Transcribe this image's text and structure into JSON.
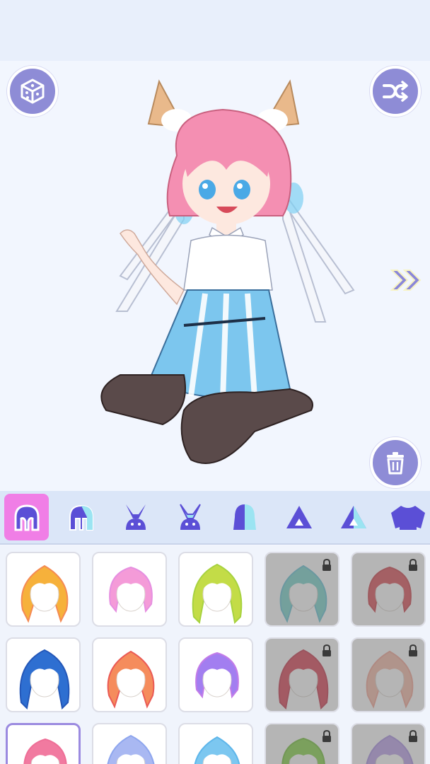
{
  "app": {
    "accent": "#8e8cd6",
    "active_tab_color": "#f07ee6",
    "next_arrow_color": "#8a87d9"
  },
  "toolbar": {
    "random_icon": "dice-icon",
    "shuffle_icon": "shuffle-icon",
    "delete_icon": "trash-icon",
    "next_icon": "double-chevron-right-icon"
  },
  "categories": [
    {
      "icon": "front-hair-icon",
      "active": true
    },
    {
      "icon": "back-hair-icon",
      "active": false
    },
    {
      "icon": "bunny-ears-icon",
      "active": false
    },
    {
      "icon": "bunny-ears-outline-icon",
      "active": false
    },
    {
      "icon": "half-head-icon",
      "active": false
    },
    {
      "icon": "triangle-icon",
      "active": false
    },
    {
      "icon": "triangle-two-tone-icon",
      "active": false
    },
    {
      "icon": "shirt-icon",
      "active": false
    }
  ],
  "hair_items": [
    {
      "color": "#f6b13b",
      "tip": "#f48a54",
      "locked": false,
      "selected": false
    },
    {
      "color": "#f49bd8",
      "tip": "#e68fe0",
      "locked": false,
      "selected": false
    },
    {
      "color": "#c3dc47",
      "tip": "#a7d23f",
      "locked": false,
      "selected": false
    },
    {
      "color": "#6fd1c8",
      "tip": "#5bbfd0",
      "locked": true,
      "selected": false
    },
    {
      "color": "#d9434d",
      "tip": "#c9353f",
      "locked": true,
      "selected": false
    },
    {
      "color": "#2e6fd1",
      "tip": "#2457b8",
      "locked": false,
      "selected": false
    },
    {
      "color": "#f58c5c",
      "tip": "#ea5a55",
      "locked": false,
      "selected": false
    },
    {
      "color": "#a27ef0",
      "tip": "#c27be8",
      "locked": false,
      "selected": false
    },
    {
      "color": "#d7354a",
      "tip": "#c42a40",
      "locked": true,
      "selected": false
    },
    {
      "color": "#f4b5a3",
      "tip": "#f29f8f",
      "locked": true,
      "selected": false
    },
    {
      "color": "#f17aa0",
      "tip": "#ee6f97",
      "locked": false,
      "selected": true
    },
    {
      "color": "#a9b8f2",
      "tip": "#8ea6ee",
      "locked": false,
      "selected": false
    },
    {
      "color": "#7cc7f0",
      "tip": "#5eb6ea",
      "locked": false,
      "selected": false
    },
    {
      "color": "#7ed13d",
      "tip": "#6bbd2e",
      "locked": true,
      "selected": false
    },
    {
      "color": "#b89be8",
      "tip": "#a48ae0",
      "locked": true,
      "selected": false
    }
  ]
}
